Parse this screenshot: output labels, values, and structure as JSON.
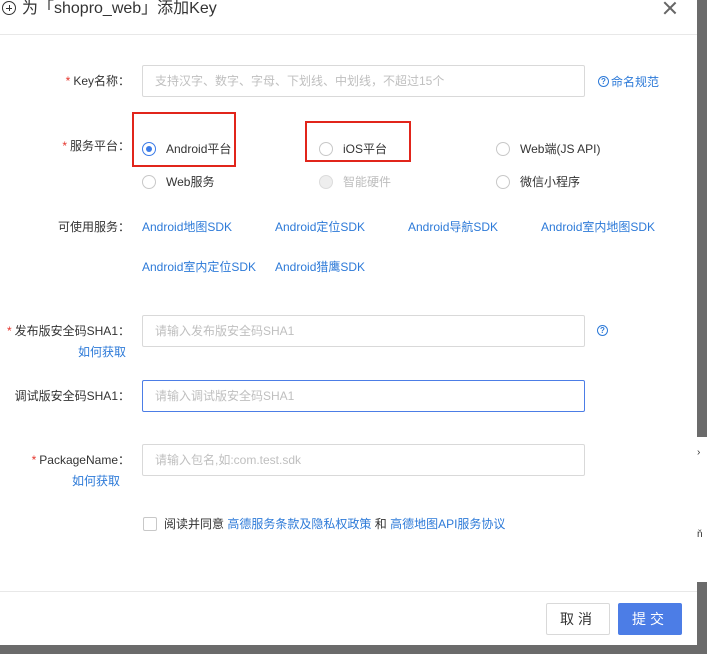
{
  "dialog": {
    "title": "为「shopro_web」添加Key",
    "close_label": "×"
  },
  "form": {
    "key_name": {
      "required_mark": "*",
      "label": "Key名称：",
      "placeholder": "支持汉字、数字、字母、下划线、中划线，不超过15个",
      "value": "",
      "help_link": "命名规范"
    },
    "platform": {
      "required_mark": "*",
      "label": "服务平台：",
      "options": [
        {
          "label": "Android平台",
          "checked": true,
          "disabled": false
        },
        {
          "label": "iOS平台",
          "checked": false,
          "disabled": false
        },
        {
          "label": "Web端(JS API)",
          "checked": false,
          "disabled": false
        },
        {
          "label": "Web服务",
          "checked": false,
          "disabled": false
        },
        {
          "label": "智能硬件",
          "checked": false,
          "disabled": true
        },
        {
          "label": "微信小程序",
          "checked": false,
          "disabled": false
        }
      ]
    },
    "services": {
      "label": "可使用服务：",
      "links": [
        "Android地图SDK",
        "Android定位SDK",
        "Android导航SDK",
        "Android室内地图SDK",
        "Android室内定位SDK",
        "Android猎鹰SDK"
      ]
    },
    "release_sha1": {
      "required_mark": "*",
      "label": "发布版安全码SHA1：",
      "how_link": "如何获取",
      "placeholder": "请输入发布版安全码SHA1",
      "value": "",
      "help_icon": "?"
    },
    "debug_sha1": {
      "label": "调试版安全码SHA1：",
      "placeholder": "请输入调试版安全码SHA1",
      "value": ""
    },
    "package_name": {
      "required_mark": "*",
      "label": "PackageName：",
      "how_link": "如何获取",
      "placeholder": "请输入包名,如:com.test.sdk",
      "value": ""
    },
    "agreement": {
      "checked": false,
      "prefix": "阅读并同意",
      "link1": "高德服务条款及隐私权政策",
      "and": "和",
      "link2": "高德地图API服务协议"
    }
  },
  "footer": {
    "cancel_label": "取消",
    "submit_label": "提交"
  },
  "side_panel": {
    "glyph1": "›",
    "glyph2": "ň"
  },
  "colors": {
    "primary": "#4c7de6",
    "link": "#2d7ad8",
    "required": "#e5352d",
    "highlight": "#e1251b"
  }
}
